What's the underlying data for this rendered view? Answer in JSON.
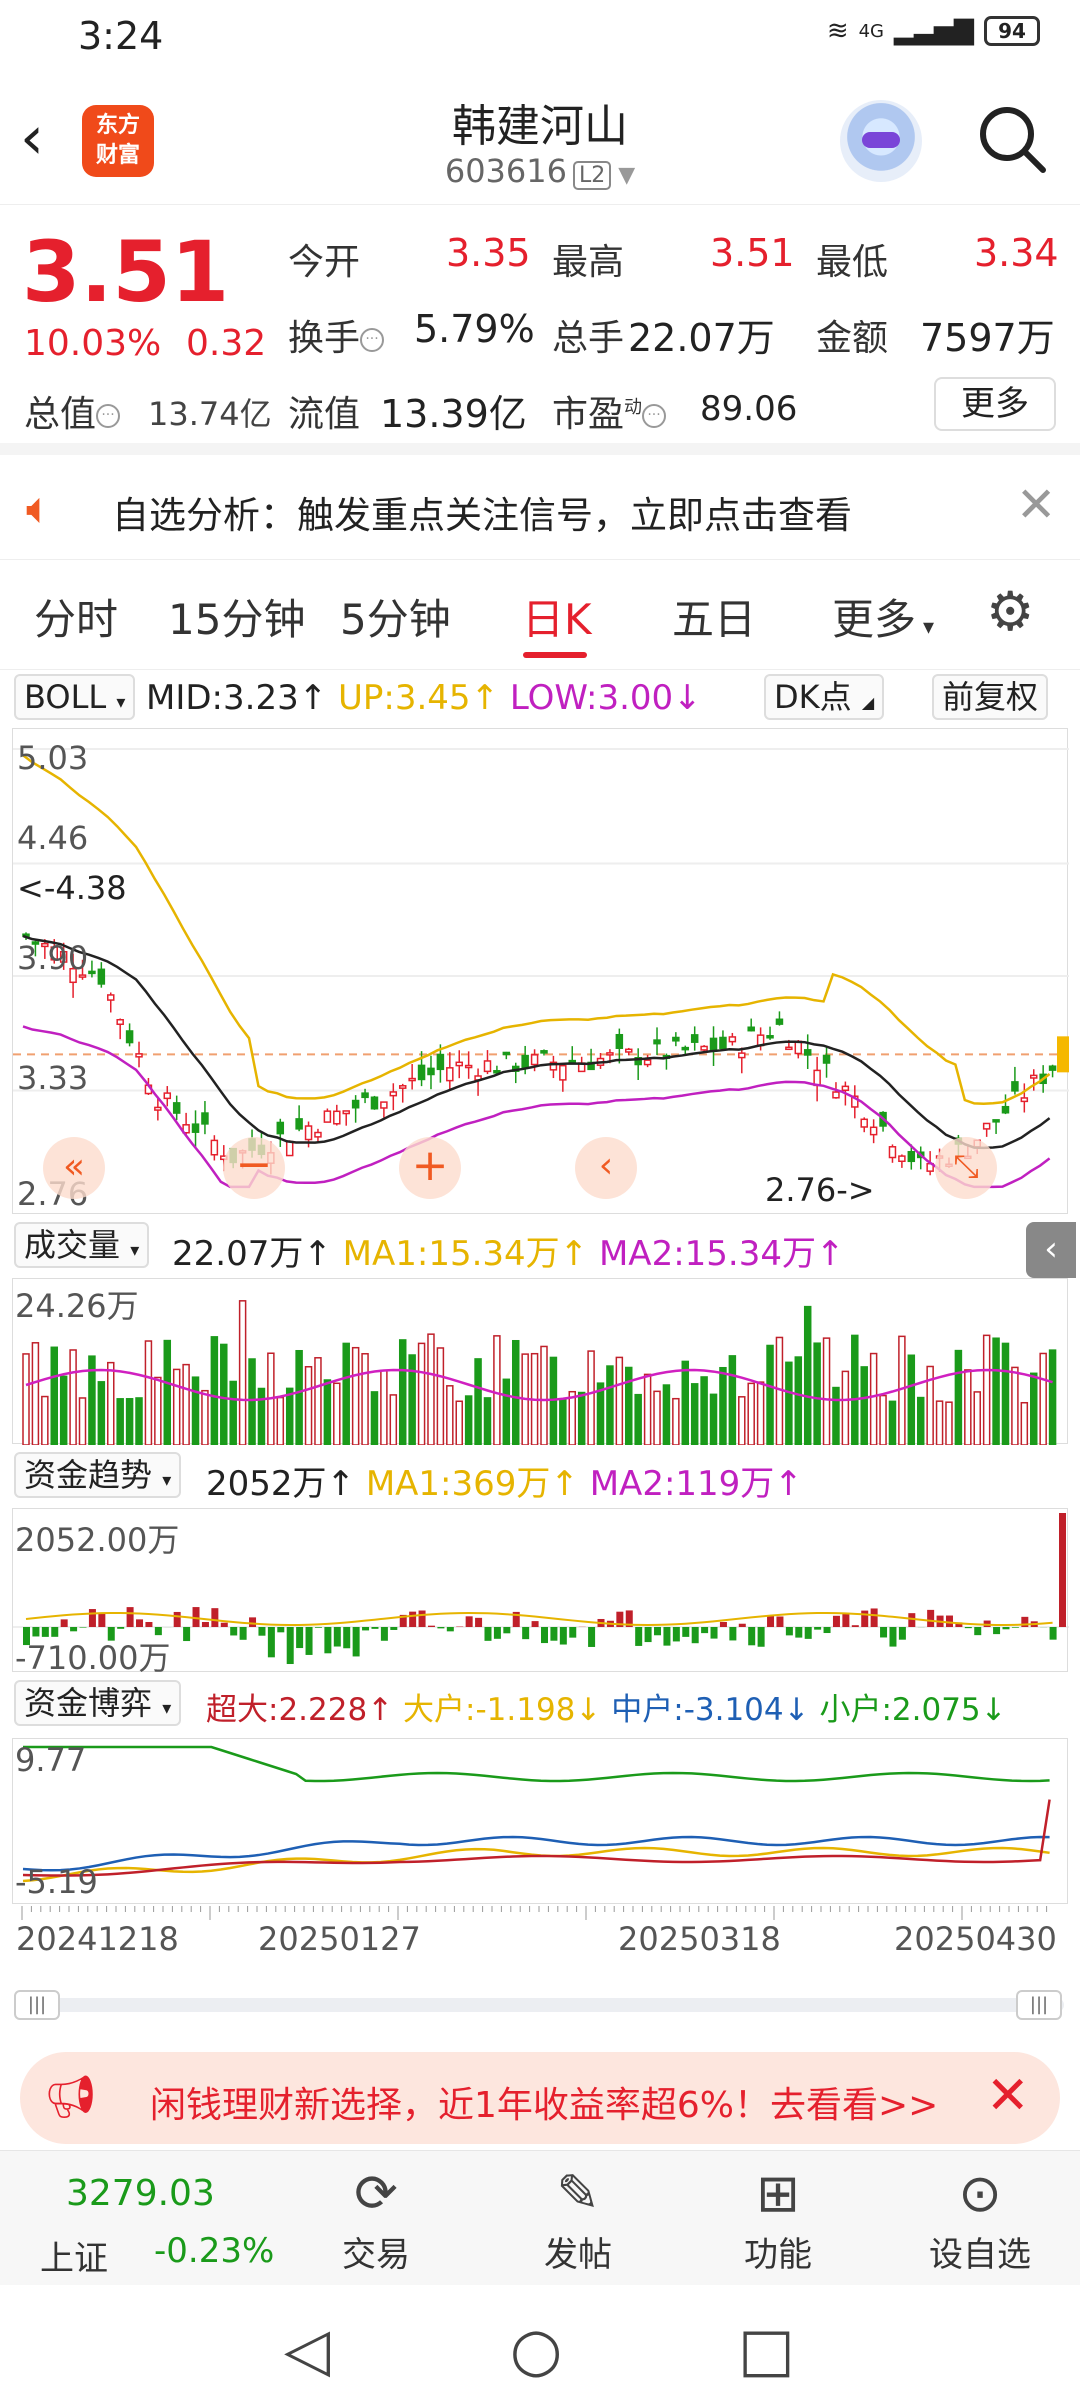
{
  "status": {
    "time": "3:24",
    "network": "4G",
    "battery": "94"
  },
  "header": {
    "stock_name": "韩建河山",
    "stock_code": "603616",
    "level": "L2",
    "logo": "东方\n财富"
  },
  "quote": {
    "price": "3.51",
    "change_pct": "10.03%",
    "change": "0.32",
    "open_label": "今开",
    "open": "3.35",
    "high_label": "最高",
    "high": "3.51",
    "low_label": "最低",
    "low": "3.34",
    "turnover_label": "换手",
    "turnover": "5.79%",
    "volume_label": "总手",
    "volume": "22.07万",
    "amount_label": "金额",
    "amount": "7597万",
    "mktcap_label": "总值",
    "mktcap": "13.74亿",
    "float_label": "流值",
    "float": "13.39亿",
    "pe_label": "市盈",
    "pe_sup": "动",
    "pe": "89.06",
    "more": "更多"
  },
  "alert": {
    "text": "自选分析：触发重点关注信号，立即点击查看"
  },
  "tabs": [
    "分时",
    "15分钟",
    "5分钟",
    "日K",
    "五日",
    "更多"
  ],
  "active_tab": "日K",
  "boll": {
    "name": "BOLL",
    "mid": "MID:3.23↑",
    "up": "UP:3.45↑",
    "low": "LOW:3.00↓",
    "dk": "DK点",
    "fq": "前复权",
    "y_top": "5.03",
    "y_2": "4.46",
    "y_3": "3.90",
    "y_4": "3.33",
    "y_bot": "2.76",
    "high_mark": "<-4.38",
    "low_mark": "2.76->",
    "colors": {
      "mid": "#222222",
      "up": "#e6b400",
      "low": "#c020c0"
    }
  },
  "volume": {
    "name": "成交量",
    "value": "22.07万↑",
    "ma1": "MA1:15.34万↑",
    "ma2": "MA2:15.34万↑",
    "y_top": "24.26万"
  },
  "fund_trend": {
    "name": "资金趋势",
    "value": "2052万↑",
    "ma1": "MA1:369万↑",
    "ma2": "MA2:119万↑",
    "y_top": "2052.00万",
    "y_bot": "-710.00万"
  },
  "fund_game": {
    "name": "资金博弈",
    "super": "超大:2.228↑",
    "large": "大户:-1.198↓",
    "mid": "中户:-3.104↓",
    "small": "小户:2.075↓",
    "y_top": "9.77",
    "y_bot": "-5.19"
  },
  "x_axis": [
    "20241218",
    "20250127",
    "20250318",
    "20250430"
  ],
  "chart_data": {
    "type": "candlestick",
    "title": "",
    "ylim": [
      2.76,
      5.03
    ],
    "x_ticks": [
      "20241218",
      "20250127",
      "20250318",
      "20250430"
    ],
    "last_close": 3.51,
    "period_high": 4.38,
    "period_low": 2.76,
    "series": [
      {
        "name": "MID",
        "last": 3.23
      },
      {
        "name": "UP",
        "last": 3.45
      },
      {
        "name": "LOW",
        "last": 3.0
      }
    ]
  },
  "promo": {
    "text": "闲钱理财新选择，近1年收益率超6%！去看看>>"
  },
  "bottom": {
    "index_value": "3279.03",
    "index_name": "上证",
    "index_change": "-0.23%",
    "items": [
      "交易",
      "发帖",
      "功能",
      "设自选"
    ]
  }
}
